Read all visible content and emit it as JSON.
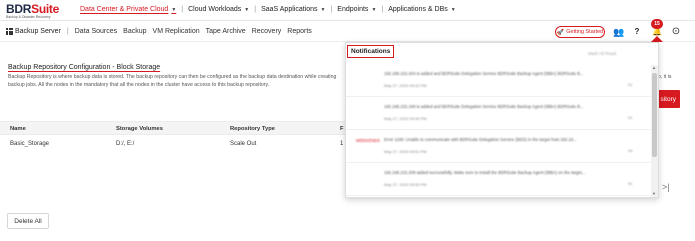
{
  "brand": {
    "name_part1": "BDR",
    "name_part2": "Suite",
    "tagline": "Backup & Disaster Recovery",
    "accent_color": "#d71920"
  },
  "top_nav": {
    "items": [
      {
        "label": "Data Center & Private Cloud",
        "active": true
      },
      {
        "label": "Cloud Workloads",
        "active": false
      },
      {
        "label": "SaaS Applications",
        "active": false
      },
      {
        "label": "Endpoints",
        "active": false
      },
      {
        "label": "Applications & DBs",
        "active": false
      }
    ],
    "separator": "|"
  },
  "sub_nav": {
    "module": "Backup Server",
    "separator": "|",
    "tabs": [
      "Data Sources",
      "Backup",
      "VM Replication",
      "Tape Archive",
      "Recovery",
      "Reports"
    ]
  },
  "header_actions": {
    "getting_started": "Getting Started",
    "rocket_icon": "🚀",
    "users_icon": "👥",
    "help_icon": "?",
    "bell_icon": "🔔",
    "bell_badge": "15",
    "user_icon": "⊙"
  },
  "page": {
    "title": "Backup Repository Configuration - Block Storage",
    "description": "Backup Repository is where backup data is stored. The backup repository can then be configured as the backup data destination while creating backup jobs. All the nodes in the mandatory that all the nodes in the cluster have access to this backup repository.",
    "description_tail": "up, it is",
    "add_button": "sitory"
  },
  "table": {
    "columns": [
      "Name",
      "Storage Volumes",
      "Repository Type",
      "F"
    ],
    "rows": [
      {
        "name": "Basic_Storage",
        "volumes": "D:/, E:/",
        "type": "Scale Out",
        "extra": "1"
      }
    ]
  },
  "pager_next": ">|",
  "delete_all": "Delete All",
  "notifications": {
    "title": "Notifications",
    "mark_read": "Mark All Read",
    "items": [
      {
        "tag": "",
        "message": "192.168.102.204 is added and BDRSuite Delegation Service BDRSuite Backup Agent (IBBA) BDRSuite B...",
        "time": "May 27, 2023 09:42 PM",
        "count": "01"
      },
      {
        "tag": "",
        "message": "192.168.102.199 is added and BDRSuite Delegation Service BDRSuite Backup Agent (IBBA) BDRSuite B...",
        "time": "May 27, 2023 09:45 PM",
        "count": "01"
      },
      {
        "tag": "WEEKENDS",
        "message": "Error 1160: Unable to communicate with BDRSuite Delegation Service (BDS) in the target host 192.16...",
        "time": "May 27, 2023 09:51 PM",
        "count": "04"
      },
      {
        "tag": "",
        "message": "192.168.102.209 added successfully. Make sure to install the BDRSuite Backup Agent (IBBA) on the target...",
        "time": "May 27, 2023 09:56 PM",
        "count": "01"
      }
    ]
  }
}
